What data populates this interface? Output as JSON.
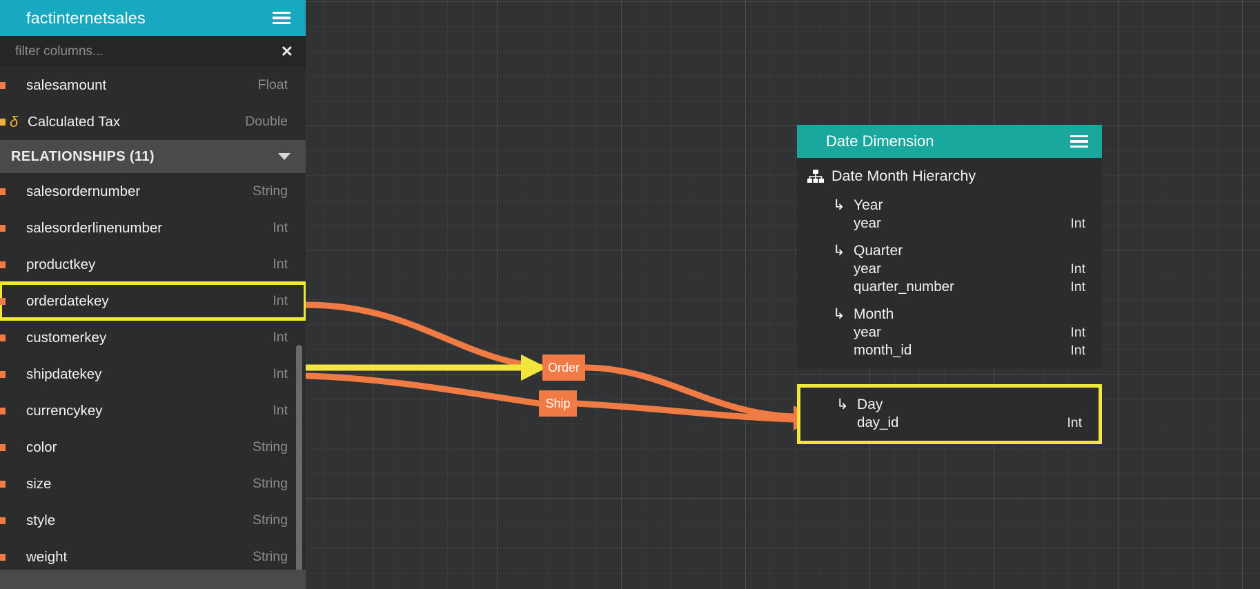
{
  "sidebar": {
    "title": "factinternetsales",
    "menu_icon": "hamburger-icon",
    "filter": {
      "placeholder": "filter columns...",
      "value": "",
      "clear_icon": "close-icon"
    },
    "top_columns": [
      {
        "name": "salesamount",
        "type": "Float",
        "calculated": false
      },
      {
        "name": "Calculated Tax",
        "type": "Double",
        "calculated": true,
        "calc_glyph": "δ"
      }
    ],
    "relationships_header": {
      "label": "RELATIONSHIPS (11)",
      "caret_icon": "chevron-down-icon"
    },
    "relationship_columns": [
      {
        "name": "salesordernumber",
        "type": "String",
        "highlighted": false
      },
      {
        "name": "salesorderlinenumber",
        "type": "Int",
        "highlighted": false
      },
      {
        "name": "productkey",
        "type": "Int",
        "highlighted": false
      },
      {
        "name": "orderdatekey",
        "type": "Int",
        "highlighted": true
      },
      {
        "name": "customerkey",
        "type": "Int",
        "highlighted": false
      },
      {
        "name": "shipdatekey",
        "type": "Int",
        "highlighted": false
      },
      {
        "name": "currencykey",
        "type": "Int",
        "highlighted": false
      },
      {
        "name": "color",
        "type": "String",
        "highlighted": false
      },
      {
        "name": "size",
        "type": "String",
        "highlighted": false
      },
      {
        "name": "style",
        "type": "String",
        "highlighted": false
      },
      {
        "name": "weight",
        "type": "String",
        "highlighted": false
      }
    ]
  },
  "date_card": {
    "title": "Date Dimension",
    "menu_icon": "hamburger-icon",
    "hierarchy": {
      "icon": "hierarchy-icon",
      "name": "Date Month Hierarchy"
    },
    "levels": [
      {
        "arrow": "↳",
        "name": "Year",
        "fields": [
          {
            "name": "year",
            "type": "Int"
          }
        ]
      },
      {
        "arrow": "↳",
        "name": "Quarter",
        "fields": [
          {
            "name": "year",
            "type": "Int"
          },
          {
            "name": "quarter_number",
            "type": "Int"
          }
        ]
      },
      {
        "arrow": "↳",
        "name": "Month",
        "fields": [
          {
            "name": "year",
            "type": "Int"
          },
          {
            "name": "month_id",
            "type": "Int"
          }
        ]
      }
    ],
    "day_level": {
      "arrow": "↳",
      "name": "Day",
      "highlighted": true,
      "fields": [
        {
          "name": "day_id",
          "type": "Int"
        }
      ]
    }
  },
  "canvas": {
    "relationship_badges": [
      {
        "label": "Order",
        "name": "order-relationship-badge"
      },
      {
        "label": "Ship",
        "name": "ship-relationship-badge"
      }
    ],
    "annotations": [
      {
        "name": "yellow-pointer-arrow",
        "kind": "arrow"
      },
      {
        "name": "orderdatekey-highlight-box",
        "kind": "box"
      },
      {
        "name": "day-level-highlight-box",
        "kind": "box"
      }
    ]
  },
  "colors": {
    "fact_header_teal": "#18a8c0",
    "dim_header_teal": "#1aa89e",
    "relationship_orange": "#f07b44",
    "highlight_yellow": "#f2e63c",
    "panel_dark": "#2c2c2c",
    "canvas_dark": "#303233",
    "calculated_gold": "#f0b23c"
  }
}
